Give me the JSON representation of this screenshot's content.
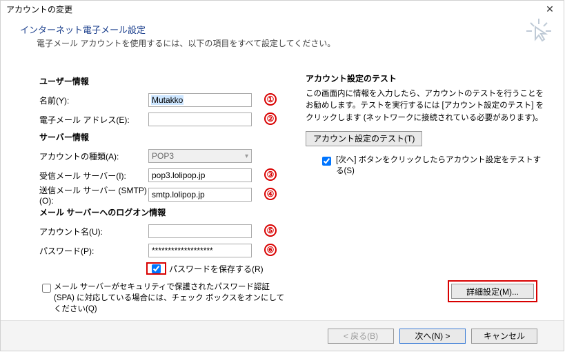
{
  "window": {
    "title": "アカウントの変更"
  },
  "header": {
    "title": "インターネット電子メール設定",
    "subtitle": "電子メール アカウントを使用するには、以下の項目をすべて設定してください。"
  },
  "left": {
    "section_user": "ユーザー情報",
    "name_label": "名前(Y):",
    "name_value": "Mutakko",
    "email_label": "電子メール アドレス(E):",
    "email_value": "",
    "section_server": "サーバー情報",
    "account_type_label": "アカウントの種類(A):",
    "account_type_value": "POP3",
    "incoming_label": "受信メール サーバー(I):",
    "incoming_value": "pop3.lolipop.jp",
    "outgoing_label": "送信メール サーバー (SMTP)(O):",
    "outgoing_value": "smtp.lolipop.jp",
    "section_logon": "メール サーバーへのログオン情報",
    "account_name_label": "アカウント名(U):",
    "account_name_value": "",
    "password_label": "パスワード(P):",
    "password_value": "*******************",
    "save_pw_label": "パスワードを保存する(R)",
    "spa_label": "メール サーバーがセキュリティで保護されたパスワード認証 (SPA) に対応している場合には、チェック ボックスをオンにしてください(Q)"
  },
  "right": {
    "title": "アカウント設定のテスト",
    "desc": "この画面内に情報を入力したら、アカウントのテストを行うことをお勧めします。テストを実行するには [アカウント設定のテスト] をクリックします (ネットワークに接続されている必要があります)。",
    "test_btn": "アカウント設定のテスト(T)",
    "next_test_label": "[次へ] ボタンをクリックしたらアカウント設定をテストする(S)",
    "more_settings_btn": "詳細設定(M)..."
  },
  "footer": {
    "back": "< 戻る(B)",
    "next": "次へ(N) >",
    "cancel": "キャンセル"
  },
  "badges": {
    "b1": "①",
    "b2": "②",
    "b3": "③",
    "b4": "④",
    "b5": "⑤",
    "b6": "⑥"
  }
}
